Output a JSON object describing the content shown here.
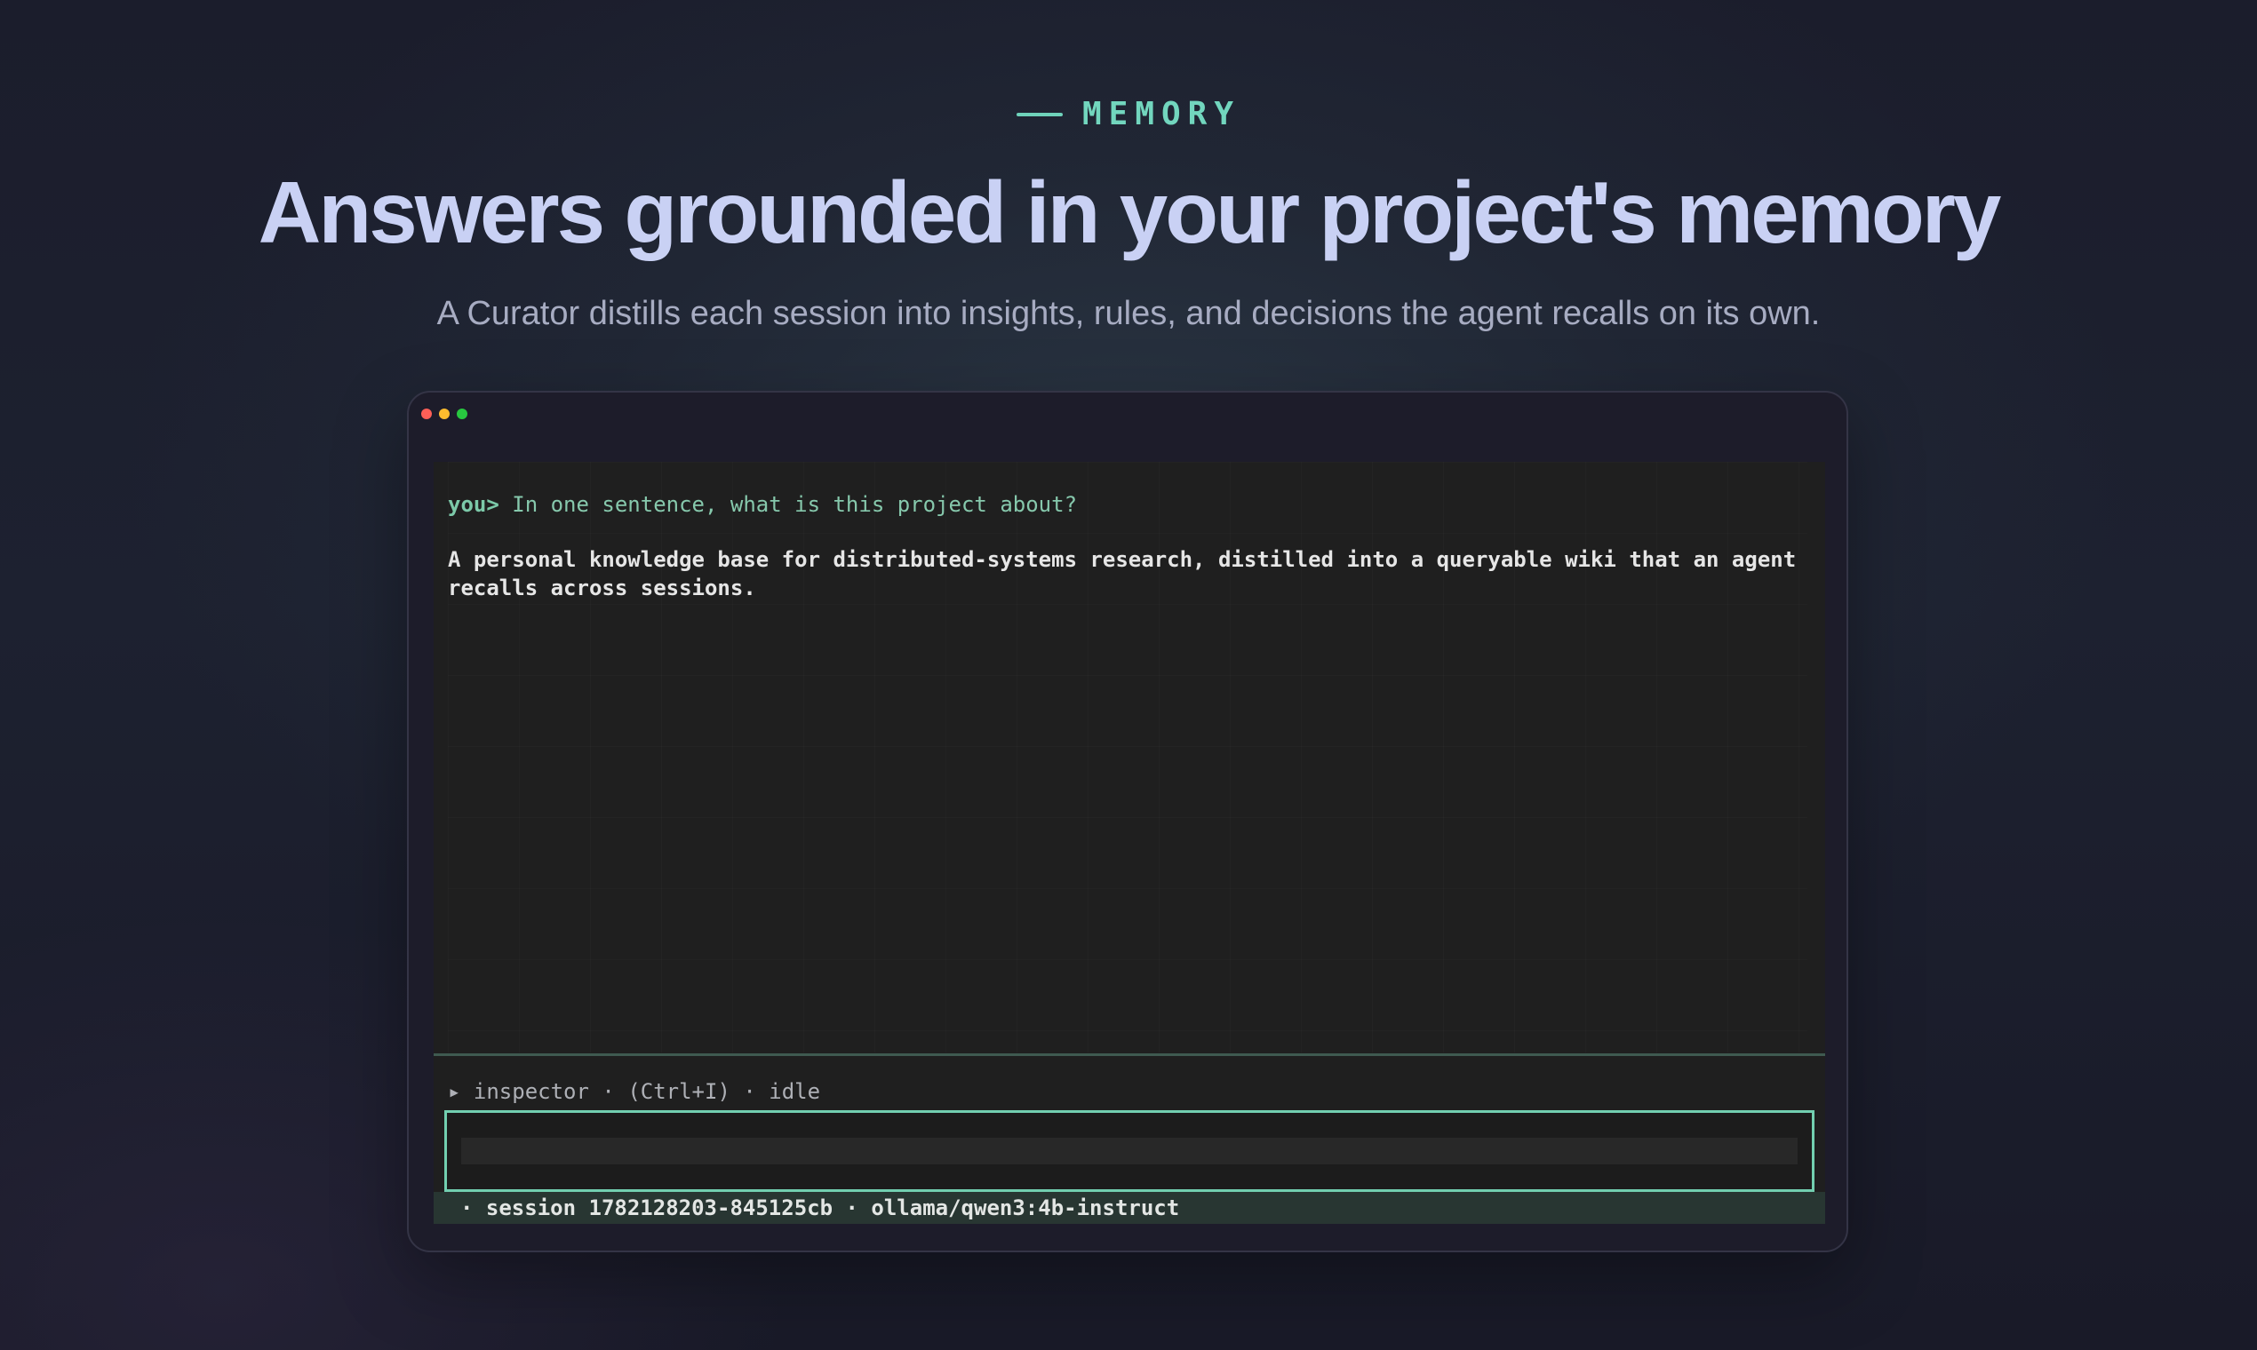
{
  "hero": {
    "eyebrow": "MEMORY",
    "title": "Answers grounded in your project's memory",
    "subtitle": "A Curator distills each session into insights, rules, and decisions the agent recalls on its own."
  },
  "terminal": {
    "prompt_prefix": "you>",
    "question": "In one sentence, what is this project about?",
    "answer": "A personal knowledge base for distributed-systems research, distilled into a queryable wiki that an agent recalls across sessions.",
    "inspector": {
      "marker": "▸",
      "label": "inspector",
      "shortcut": "(Ctrl+I)",
      "state": "idle",
      "separator": "·"
    },
    "input": {
      "value": "",
      "placeholder": ""
    },
    "status": {
      "bullet": "·",
      "session": "session 1782128203-845125cb",
      "separator": "·",
      "model": "ollama/qwen3:4b-instruct"
    }
  },
  "colors": {
    "accent": "#72d6be",
    "title": "#c9d1f4",
    "traffic_red": "#ff5f57",
    "traffic_yellow": "#febc2e",
    "traffic_green": "#28c840"
  }
}
